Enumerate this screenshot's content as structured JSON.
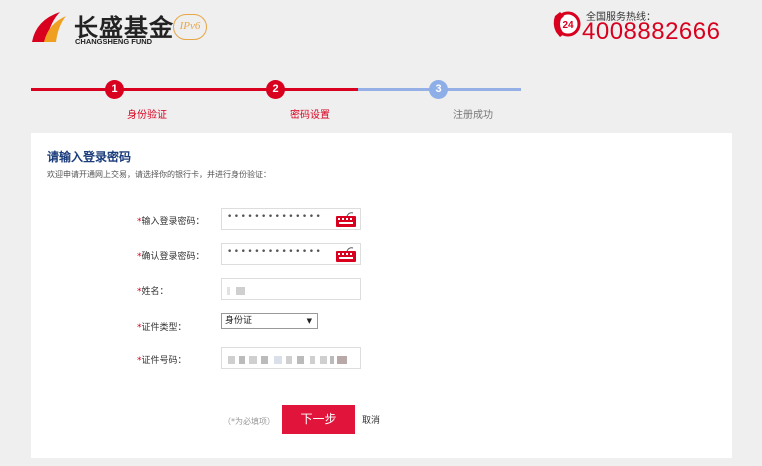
{
  "header": {
    "logo_cn": "长盛基金",
    "logo_en": "CHANGSHENG FUND",
    "logo_badge": "IPv6",
    "hotline_badge": "24",
    "hotline_label": "全国服务热线：",
    "hotline_number": "4008882666"
  },
  "steps": [
    {
      "num": "1",
      "label": "身份验证",
      "state": "done"
    },
    {
      "num": "2",
      "label": "密码设置",
      "state": "current"
    },
    {
      "num": "3",
      "label": "注册成功",
      "state": "pending"
    }
  ],
  "form": {
    "title": "请输入登录密码",
    "subtitle": "欢迎申请开通网上交易，请选择你的银行卡，并进行身份验证：",
    "required_mark": "*",
    "fields": {
      "password": {
        "label": "输入登录密码：",
        "value": "••••••••••••••"
      },
      "confirm": {
        "label": "确认登录密码：",
        "value": "••••••••••••••"
      },
      "name": {
        "label": "姓名："
      },
      "id_type": {
        "label": "证件类型：",
        "selected": "身份证"
      },
      "id_number": {
        "label": "证件号码："
      }
    },
    "required_note": "（*为必填项）",
    "next_label": "下一步",
    "cancel_label": "取消"
  },
  "colors": {
    "brand_red": "#d8001e",
    "step_pending": "#94b0e6",
    "title_blue": "#1b3d7c",
    "button_red": "#e1143c"
  }
}
